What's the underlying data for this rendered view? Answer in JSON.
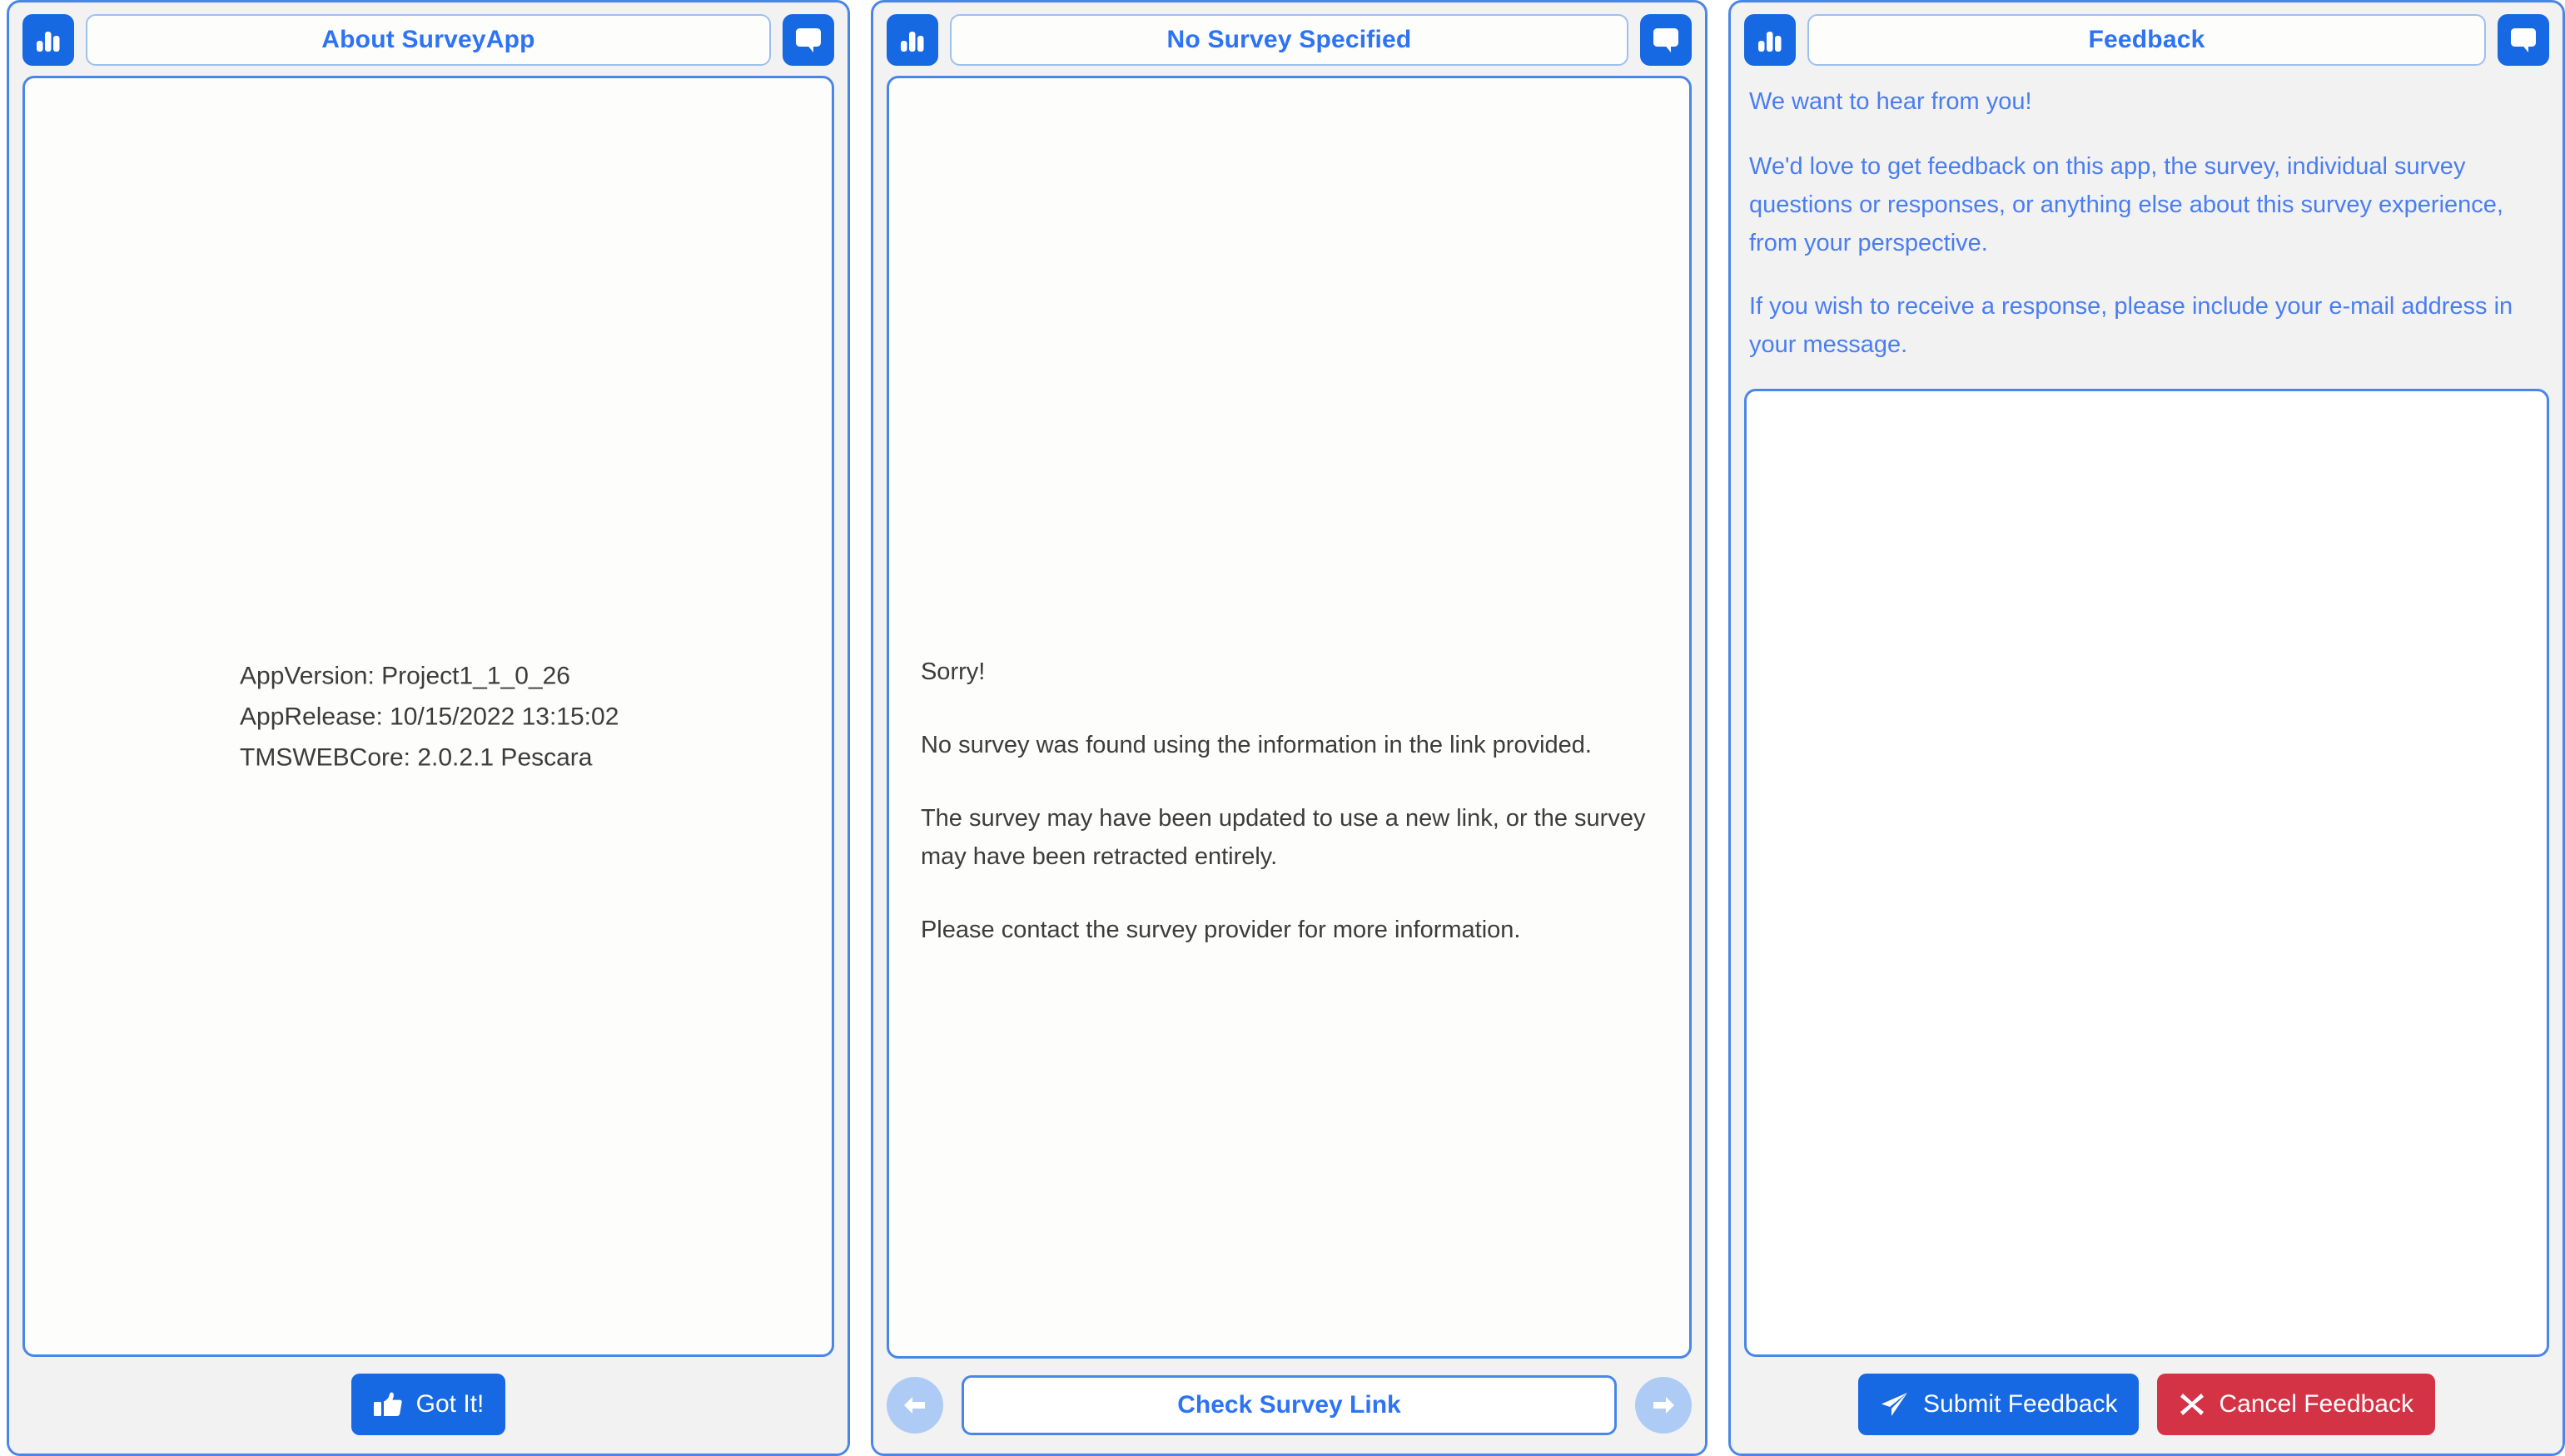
{
  "app": {
    "accent_blue": "#2d73f5",
    "icon_blue": "#1668e3",
    "danger_red": "#d43346",
    "panel_bg": "#f2f2f2",
    "content_bg": "#fdfdfc",
    "border_blue": "#4a86e8"
  },
  "panels": {
    "about": {
      "title": "About SurveyApp",
      "chart_icon": "bar-chart-icon",
      "feedback_icon": "speech-bubble-icon",
      "lines": [
        "AppVersion: Project1_1_0_26",
        "AppRelease: 10/15/2022 13:15:02",
        "TMSWEBCore: 2.0.2.1 Pescara"
      ],
      "footer": {
        "got_it_label": "Got It!",
        "got_it_icon": "thumbs-up-icon"
      }
    },
    "survey": {
      "title": "No Survey Specified",
      "chart_icon": "bar-chart-icon",
      "feedback_icon": "speech-bubble-icon",
      "paragraphs": [
        "Sorry!",
        "No survey was found using the information in the link provided.",
        "The survey may have been updated to use a new link, or the survey may have been retracted entirely.",
        "Please contact the survey provider for more information."
      ],
      "footer": {
        "prev_icon": "arrow-left-icon",
        "next_icon": "arrow-right-icon",
        "check_link_label": "Check Survey Link"
      }
    },
    "feedback": {
      "title": "Feedback",
      "chart_icon": "bar-chart-icon",
      "feedback_icon": "speech-bubble-icon",
      "paragraphs": [
        "We want to hear from you!",
        "We'd love to get feedback on this app, the survey, individual survey questions or responses, or anything else about this survey experience, from your perspective.",
        "If you wish to receive a response, please include your e-mail address in your message."
      ],
      "textarea": {
        "value": "",
        "placeholder": ""
      },
      "footer": {
        "submit_label": "Submit Feedback",
        "submit_icon": "paper-plane-icon",
        "cancel_label": "Cancel Feedback",
        "cancel_icon": "close-x-icon"
      }
    }
  }
}
